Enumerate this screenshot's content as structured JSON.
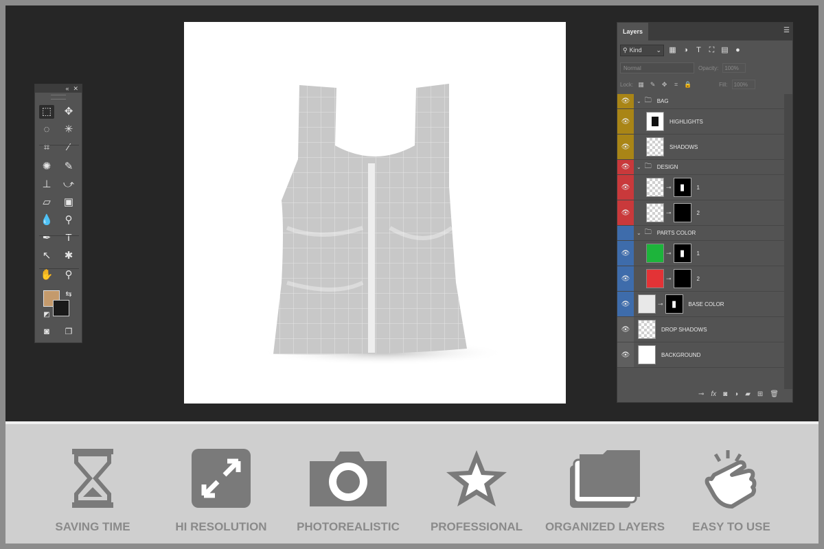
{
  "tools": [
    {
      "icon": "marquee-icon",
      "glyph": "⬚"
    },
    {
      "icon": "move-icon",
      "glyph": "✥"
    },
    {
      "icon": "lasso-icon",
      "glyph": "◌"
    },
    {
      "icon": "magic-wand-icon",
      "glyph": "✳"
    },
    {
      "icon": "crop-icon",
      "glyph": "⌗"
    },
    {
      "icon": "eyedropper-icon",
      "glyph": "⁄"
    },
    {
      "icon": "healing-brush-icon",
      "glyph": "✺"
    },
    {
      "icon": "brush-icon",
      "glyph": "✎"
    },
    {
      "icon": "clone-stamp-icon",
      "glyph": "⊥"
    },
    {
      "icon": "history-brush-icon",
      "glyph": "⤻"
    },
    {
      "icon": "eraser-icon",
      "glyph": "▱"
    },
    {
      "icon": "gradient-icon",
      "glyph": "▣"
    },
    {
      "icon": "blur-icon",
      "glyph": "💧"
    },
    {
      "icon": "dodge-icon",
      "glyph": "⚲"
    },
    {
      "icon": "pen-icon",
      "glyph": "✒"
    },
    {
      "icon": "type-icon",
      "glyph": "T"
    },
    {
      "icon": "path-selection-icon",
      "glyph": "↖"
    },
    {
      "icon": "custom-shape-icon",
      "glyph": "✱"
    },
    {
      "icon": "hand-icon",
      "glyph": "✋"
    },
    {
      "icon": "zoom-icon",
      "glyph": "⚲"
    }
  ],
  "colors": {
    "foreground": "#c49a6c",
    "background": "#1a1a1a"
  },
  "layers_panel": {
    "tab": "Layers",
    "filter_kind": "Kind",
    "blend_mode": "Normal",
    "opacity_label": "Opacity:",
    "opacity_value": "100%",
    "lock_label": "Lock:",
    "fill_label": "Fill:",
    "fill_value": "100%",
    "layers": [
      {
        "name": "BAG",
        "type": "group",
        "color": "yellow"
      },
      {
        "name": "HIGHLIGHTS",
        "type": "layer",
        "color": "yellow"
      },
      {
        "name": "SHADOWS",
        "type": "layer",
        "color": "yellow"
      },
      {
        "name": "DESIGN",
        "type": "group",
        "color": "red"
      },
      {
        "name": "1",
        "type": "smart",
        "color": "red"
      },
      {
        "name": "2",
        "type": "smart",
        "color": "red"
      },
      {
        "name": "PARTS COLOR",
        "type": "group",
        "color": "blue"
      },
      {
        "name": "1",
        "type": "fill",
        "color": "blue",
        "swatch": "#1db43b"
      },
      {
        "name": "2",
        "type": "fill",
        "color": "blue",
        "swatch": "#e33336"
      },
      {
        "name": "BASE COLOR",
        "type": "fill",
        "color": "blue",
        "swatch": "#e8e8e8"
      },
      {
        "name": "DROP SHADOWS",
        "type": "layer",
        "color": "gray"
      },
      {
        "name": "BACKGROUND",
        "type": "fill",
        "color": "gray",
        "swatch": "#ffffff"
      }
    ]
  },
  "features": [
    {
      "label": "SAVING TIME",
      "icon": "hourglass-icon"
    },
    {
      "label": "HI RESOLUTION",
      "icon": "expand-icon"
    },
    {
      "label": "PHOTOREALISTIC",
      "icon": "camera-icon"
    },
    {
      "label": "PROFESSIONAL",
      "icon": "star-icon"
    },
    {
      "label": "ORGANIZED LAYERS",
      "icon": "layers-icon"
    },
    {
      "label": "EASY TO USE",
      "icon": "tap-hand-icon"
    }
  ]
}
